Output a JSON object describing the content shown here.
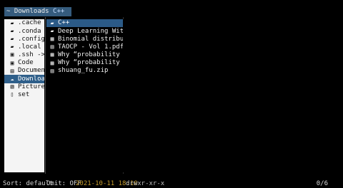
{
  "title_bar": {
    "prefix": "~ Downloads",
    "accent": "C++"
  },
  "parent_pane": {
    "items": [
      {
        "icon": "folder-icon",
        "glyph": "▰",
        "label": ".cache",
        "selected": false
      },
      {
        "icon": "folder-icon",
        "glyph": "▰",
        "label": ".conda",
        "selected": false
      },
      {
        "icon": "folder-icon",
        "glyph": "▰",
        "label": ".config",
        "selected": false
      },
      {
        "icon": "folder-icon",
        "glyph": "▰",
        "label": ".local",
        "selected": false
      },
      {
        "icon": "folder-link-icon",
        "glyph": "▣",
        "label": ".ssh ->",
        "selected": false
      },
      {
        "icon": "code-folder-icon",
        "glyph": "▣",
        "label": "Code",
        "selected": false
      },
      {
        "icon": "documents-icon",
        "glyph": "▤",
        "label": "Document",
        "selected": false
      },
      {
        "icon": "downloads-icon",
        "glyph": "☁",
        "label": "Download",
        "selected": true
      },
      {
        "icon": "pictures-icon",
        "glyph": "▧",
        "label": "Pictures",
        "selected": false
      },
      {
        "icon": "file-icon",
        "glyph": "▯",
        "label": "set",
        "selected": false
      }
    ]
  },
  "current_pane": {
    "items": [
      {
        "icon": "folder-icon",
        "glyph": "▰",
        "label": "C++",
        "selected": true
      },
      {
        "icon": "folder-icon",
        "glyph": "▰",
        "label": "Deep Learning With T",
        "selected": false
      },
      {
        "icon": "video-icon",
        "glyph": "▦",
        "label": "Binomial distributio",
        "selected": false
      },
      {
        "icon": "pdf-icon",
        "glyph": "▤",
        "label": "TAOCP - Vol 1.pdf",
        "selected": false
      },
      {
        "icon": "video-icon",
        "glyph": "▦",
        "label": "Why “probability of",
        "selected": false
      },
      {
        "icon": "video-icon",
        "glyph": "▦",
        "label": "Why “probability of",
        "selected": false
      },
      {
        "icon": "archive-icon",
        "glyph": "▥",
        "label": "shuang_fu.zip",
        "selected": false
      }
    ]
  },
  "status_bar": {
    "sort": "Sort: default",
    "omit": "Omit: OFF",
    "date": "2021-10-11 18:10",
    "permissions": "drwxr-xr-x",
    "count": "0/6"
  },
  "colors": {
    "background": "#000000",
    "selection": "#2b5a87",
    "parent_background": "#f4f4f4",
    "date_text": "#c49b2c"
  }
}
